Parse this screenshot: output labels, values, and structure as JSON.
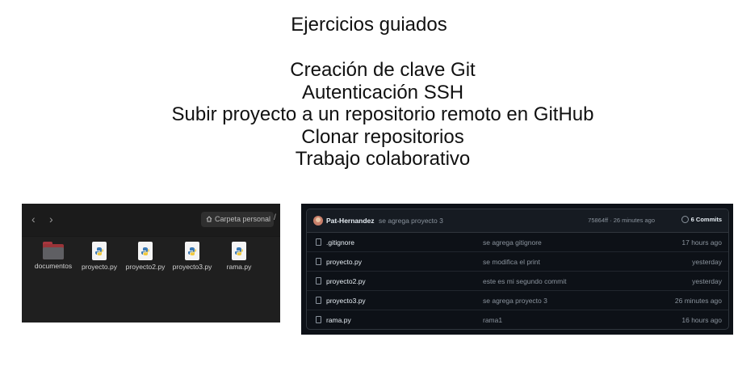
{
  "slide": {
    "title": "Ejercicios guiados",
    "topics": [
      "Creación de clave Git",
      "Autenticación SSH",
      "Subir proyecto a un repositorio remoto en GitHub",
      "Clonar repositorios",
      "Trabajo colaborativo"
    ]
  },
  "file_manager": {
    "back_icon": "‹",
    "forward_icon": "›",
    "path_label": "Carpeta personal",
    "path_separator": "/",
    "items": [
      {
        "label": "documentos",
        "icon": "folder-icon"
      },
      {
        "label": "proyecto.py",
        "icon": "python-file-icon"
      },
      {
        "label": "proyecto2.py",
        "icon": "python-file-icon"
      },
      {
        "label": "proyecto3.py",
        "icon": "python-file-icon"
      },
      {
        "label": "rama.py",
        "icon": "python-file-icon"
      }
    ]
  },
  "github": {
    "author": "Pat-Hernandez",
    "latest_message": "se agrega proyecto 3",
    "commit_hash_time": "75864ff · 26 minutes ago",
    "commits_label": "6 Commits",
    "files": [
      {
        "name": ".gitignore",
        "message": "se agrega gitignore",
        "time": "17 hours ago"
      },
      {
        "name": "proyecto.py",
        "message": "se modifica el print",
        "time": "yesterday"
      },
      {
        "name": "proyecto2.py",
        "message": "este es mi segundo commit",
        "time": "yesterday"
      },
      {
        "name": "proyecto3.py",
        "message": "se agrega proyecto 3",
        "time": "26 minutes ago"
      },
      {
        "name": "rama.py",
        "message": "rama1",
        "time": "16 hours ago"
      }
    ],
    "colors": {
      "background": "#0d1117",
      "border": "#30363d",
      "text": "#e6edf3",
      "muted": "#8b949e"
    }
  }
}
